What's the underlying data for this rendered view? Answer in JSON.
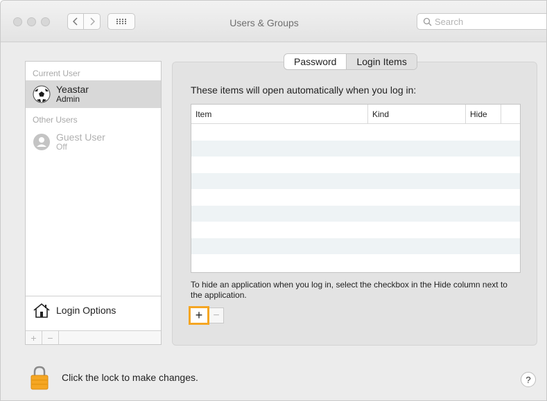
{
  "window": {
    "title": "Users & Groups"
  },
  "search": {
    "placeholder": "Search"
  },
  "sidebar": {
    "current_header": "Current User",
    "other_header": "Other Users",
    "current_user": {
      "name": "Yeastar",
      "role": "Admin"
    },
    "guest_user": {
      "name": "Guest User",
      "role": "Off"
    },
    "login_options": "Login Options",
    "add_label": "+",
    "remove_label": "−"
  },
  "tabs": [
    {
      "label": "Password",
      "selected": false
    },
    {
      "label": "Login Items",
      "selected": true
    }
  ],
  "main": {
    "intro": "These items will open automatically when you log in:",
    "columns": {
      "item": "Item",
      "kind": "Kind",
      "hide": "Hide"
    },
    "hint": "To hide an application when you log in, select the checkbox in the Hide column next to the application.",
    "add_label": "+",
    "remove_label": "−"
  },
  "footer": {
    "lock_text": "Click the lock to make changes.",
    "help_label": "?"
  },
  "colors": {
    "highlight": "#f5a623",
    "lock": "#f5a623",
    "selection": "#d8d8d8"
  },
  "icons": [
    "back-icon",
    "forward-icon",
    "grid-icon",
    "search-icon",
    "soccer-ball-avatar",
    "guest-avatar",
    "house-icon",
    "lock-icon",
    "help-icon"
  ]
}
